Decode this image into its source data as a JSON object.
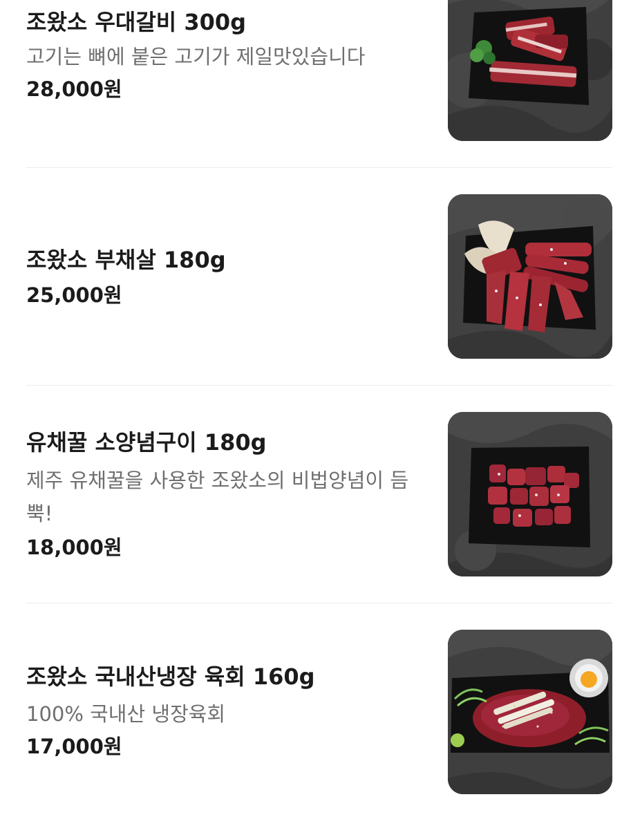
{
  "menu": {
    "items": [
      {
        "name": "조왔소 우대갈비 300g",
        "description": "고기는 뼈에 붙은 고기가 제일맛있습니다",
        "price": "28,000원",
        "image": "beef-short-ribs-photo"
      },
      {
        "name": "조왔소 부채살 180g",
        "description": "",
        "price": "25,000원",
        "image": "flat-iron-steak-photo"
      },
      {
        "name": "유채꿀 소양념구이 180g",
        "description": "제주 유채꿀을 사용한 조왔소의 비법양념이 듬뿍!",
        "price": "18,000원",
        "image": "marinated-beef-cubes-photo"
      },
      {
        "name": "조왔소 국내산냉장 육회 160g",
        "description": "100% 국내산 냉장육회",
        "price": "17,000원",
        "image": "beef-tartare-photo"
      }
    ]
  }
}
